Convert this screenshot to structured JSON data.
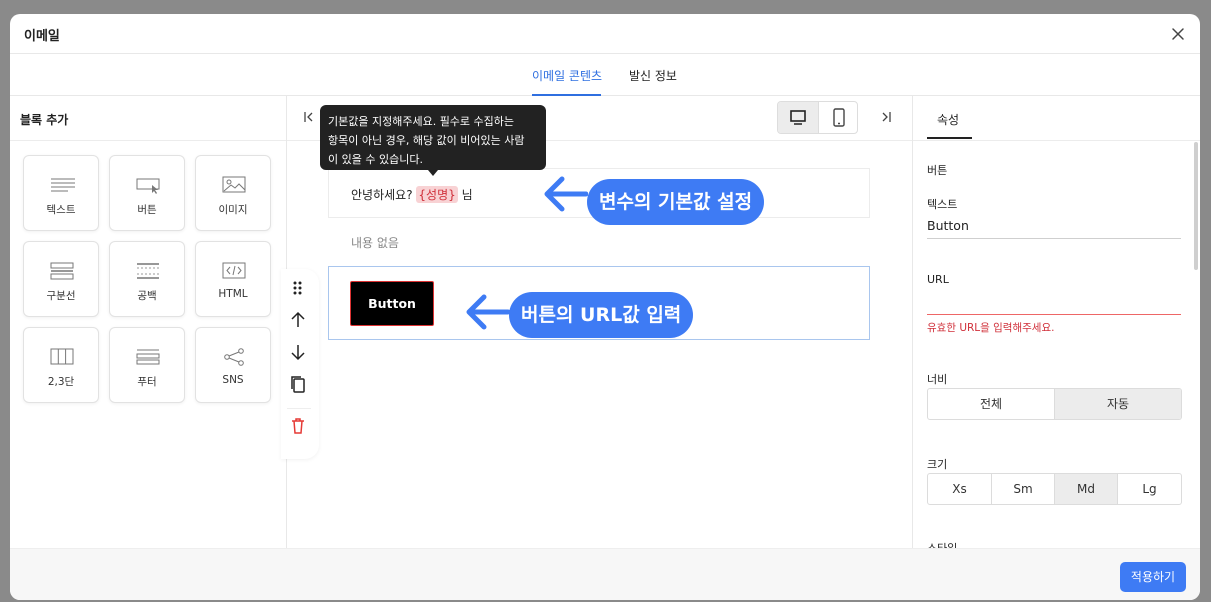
{
  "modal": {
    "title": "이메일"
  },
  "tabs": [
    {
      "label": "이메일 콘텐츠",
      "active": true
    },
    {
      "label": "발신 정보",
      "active": false
    }
  ],
  "blocks_panel": {
    "title": "블록 추가",
    "blocks": [
      {
        "label": "텍스트",
        "icon": "text-lines-icon"
      },
      {
        "label": "버튼",
        "icon": "button-cursor-icon"
      },
      {
        "label": "이미지",
        "icon": "image-icon"
      },
      {
        "label": "구분선",
        "icon": "divider-icon"
      },
      {
        "label": "공백",
        "icon": "spacer-icon"
      },
      {
        "label": "HTML",
        "icon": "code-icon"
      },
      {
        "label": "2,3단",
        "icon": "columns-icon"
      },
      {
        "label": "푸터",
        "icon": "footer-icon"
      },
      {
        "label": "SNS",
        "icon": "share-icon"
      }
    ]
  },
  "canvas": {
    "tooltip": {
      "line1": "기본값을 지정해주세요. 필수로 수집하는",
      "line2": "항목이 아닌 경우, 해당 값이 비어있는 사람",
      "line3": "이 있을 수 있습니다."
    },
    "greeting": {
      "prefix": "안녕하세요?",
      "variable": "{성명}",
      "suffix": "님"
    },
    "empty_text": "내용 없음",
    "button_label": "Button",
    "device_selected": "desktop"
  },
  "callouts": {
    "variable_default": "변수의 기본값 설정",
    "button_url": "버튼의 URL값 입력"
  },
  "properties": {
    "tab": "속성",
    "section": "버튼",
    "text_label": "텍스트",
    "text_value": "Button",
    "url_label": "URL",
    "url_value": "",
    "url_error": "유효한 URL을 입력해주세요.",
    "width_label": "너비",
    "width_options": [
      {
        "label": "전체",
        "active": false
      },
      {
        "label": "자동",
        "active": true
      }
    ],
    "size_label": "크기",
    "size_options": [
      {
        "label": "Xs",
        "active": false
      },
      {
        "label": "Sm",
        "active": false
      },
      {
        "label": "Md",
        "active": true
      },
      {
        "label": "Lg",
        "active": false
      }
    ],
    "style_label": "스타일"
  },
  "footer": {
    "apply_label": "적용하기"
  },
  "colors": {
    "accent": "#3e7bf4",
    "tab_active": "#2f6fe0",
    "error": "#d0303a",
    "variable_bg": "#f8d2d4"
  }
}
